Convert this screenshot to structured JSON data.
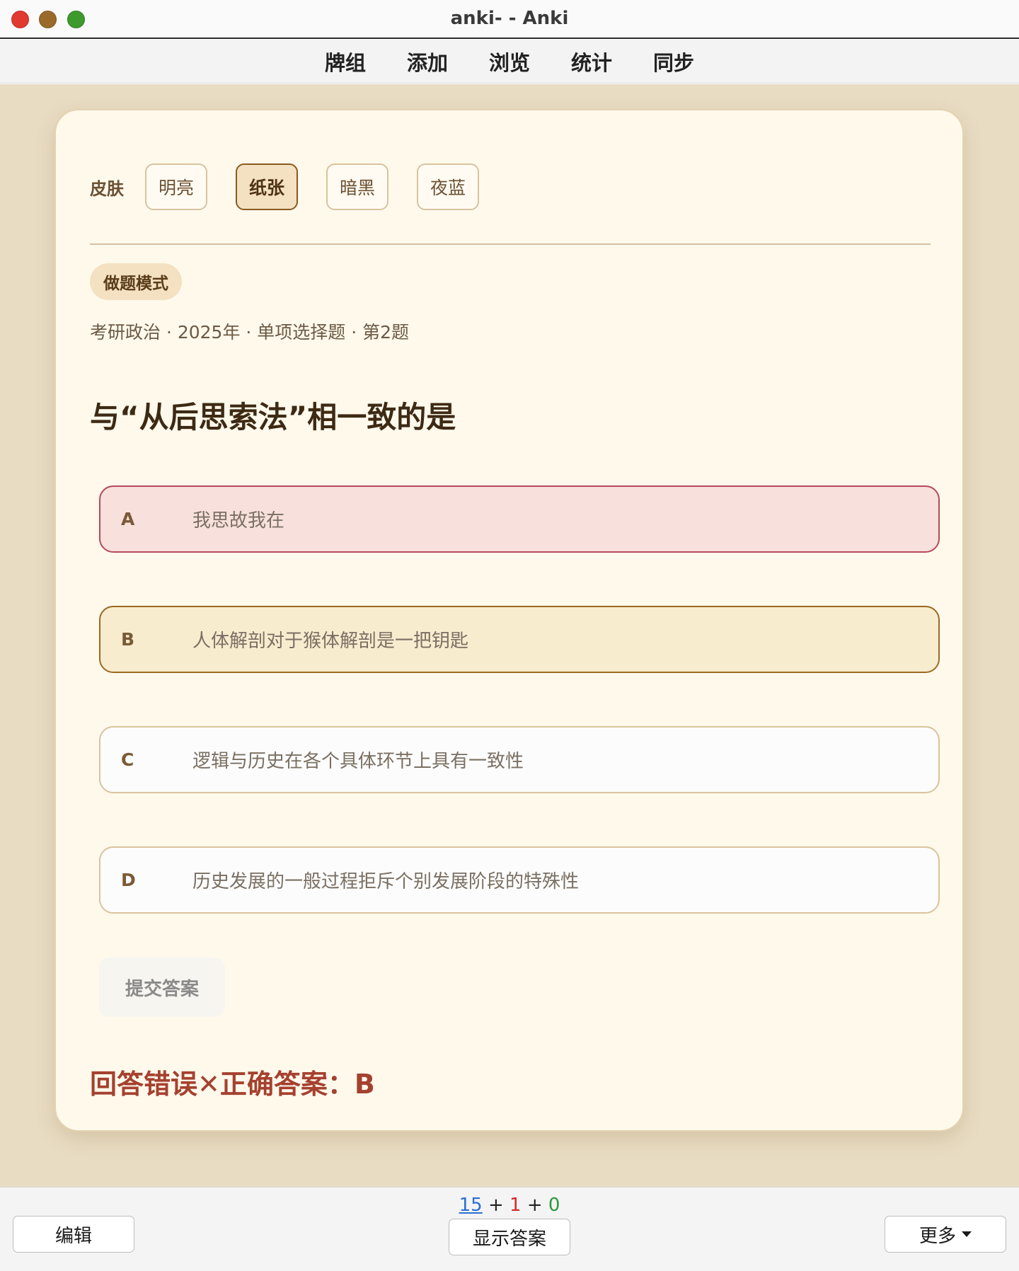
{
  "window": {
    "title": "anki- - Anki"
  },
  "menu": {
    "items": [
      "牌组",
      "添加",
      "浏览",
      "统计",
      "同步"
    ]
  },
  "card": {
    "skin_label": "皮肤",
    "skins": [
      "明亮",
      "纸张",
      "暗黑",
      "夜蓝"
    ],
    "active_skin": "纸张",
    "mode_badge": "做题模式",
    "meta": "考研政治 · 2025年 · 单项选择题 · 第2题",
    "question": "与“从后思索法”相一致的是",
    "options": [
      {
        "letter": "A",
        "text": "我思故我在",
        "state": "wrong"
      },
      {
        "letter": "B",
        "text": "人体解剖对于猴体解剖是一把钥匙",
        "state": "correct"
      },
      {
        "letter": "C",
        "text": "逻辑与历史在各个具体环节上具有一致性",
        "state": "normal"
      },
      {
        "letter": "D",
        "text": "历史发展的一般过程拒斥个别发展阶段的特殊性",
        "state": "normal"
      }
    ],
    "submit_label": "提交答案",
    "result": "回答错误✕正确答案：B"
  },
  "bottom": {
    "counts": {
      "new": "15",
      "learn": "1",
      "review": "0",
      "sep": "+"
    },
    "edit_label": "编辑",
    "show_answer_label": "显示答案",
    "more_label": "更多"
  },
  "colors": {
    "stage_bg": "#e8dcc3",
    "card_bg": "#fff9ec",
    "wrong_bg": "#f8e0dc",
    "correct_bg": "#f8eccf",
    "result_text": "#a5412f",
    "new_count": "#2b6fd6",
    "learn_count": "#d42b2b",
    "review_count": "#2a9a3a"
  }
}
